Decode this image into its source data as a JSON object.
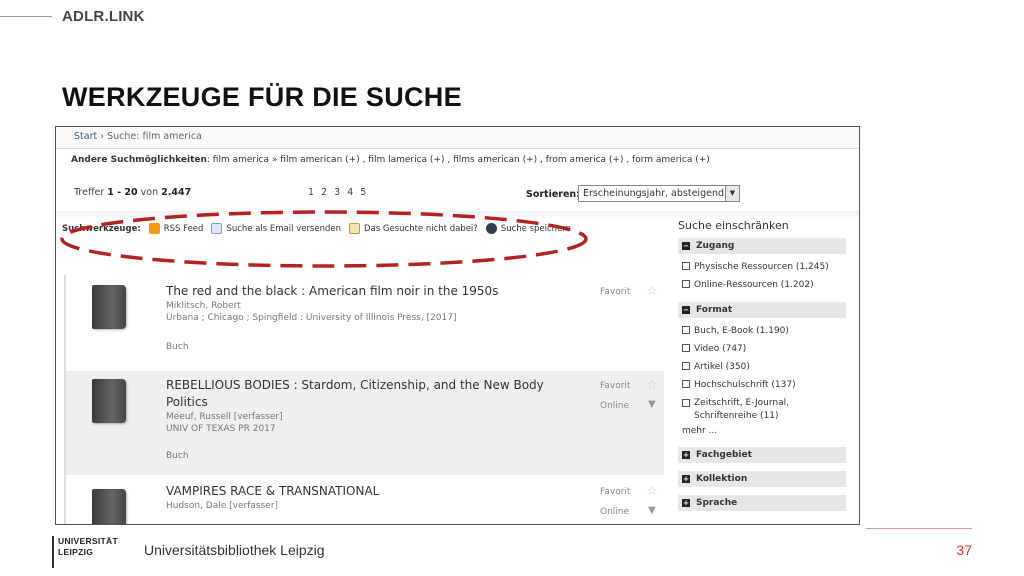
{
  "slide": {
    "brand": "ADLR.LINK",
    "title": "WERKZEUGE FÜR DIE SUCHE",
    "footer_text": "Universitätsbibliothek Leipzig",
    "page_number": "37",
    "logo_line1": "UNIVERSITÄT",
    "logo_line2": "LEIPZIG",
    "accent_color": "#c0392b"
  },
  "breadcrumb": {
    "home": "Start",
    "separator": "›",
    "current": "Suche: film america"
  },
  "alternatives": {
    "label": "Andere Suchmöglichkeiten",
    "text": ": film america » film american (+) , film lamerica (+) , films american (+) , from america (+) , form america (+)"
  },
  "hits": {
    "prefix": "Treffer ",
    "range": "1 - 20",
    "of": " von ",
    "total": "2.447",
    "pages": "1 2 3 4 5"
  },
  "sort": {
    "label": "Sortieren:",
    "value": "Erscheinungsjahr, absteigend"
  },
  "tools": {
    "label": "Suchwerkzeuge:",
    "rss": "RSS Feed",
    "email": "Suche als Email versenden",
    "missing": "Das Gesuchte nicht dabei?",
    "save": "Suche speichern"
  },
  "results": [
    {
      "title": "The red and the black : American film noir in the 1950s",
      "author": "Miklitsch, Robert",
      "publisher": "Urbana ; Chicago ; Spingfield : University of Illinois Press, [2017]",
      "type": "Buch",
      "favorite": "Favorit"
    },
    {
      "title": "REBELLIOUS BODIES : Stardom, Citizenship, and the New Body Politics",
      "author": "Meeuf, Russell [verfasser]",
      "publisher": "UNIV OF TEXAS PR 2017",
      "type": "Buch",
      "favorite": "Favorit",
      "online": "Online"
    },
    {
      "title": "VAMPIRES RACE & TRANSNATIONAL",
      "author": "Hudson, Dale [verfasser]",
      "favorite": "Favorit",
      "online": "Online"
    }
  ],
  "facets": {
    "heading": "Suche einschränken",
    "zugang": {
      "label": "Zugang",
      "items": [
        "Physische Ressourcen (1.245)",
        "Online-Ressourcen (1.202)"
      ]
    },
    "format": {
      "label": "Format",
      "items": [
        "Buch, E-Book (1.190)",
        "Video (747)",
        "Artikel (350)",
        "Hochschulschrift (137)",
        "Zeitschrift, E-Journal, Schriftenreihe (11)"
      ],
      "more": "mehr ..."
    },
    "fachgebiet": "Fachgebiet",
    "kollektion": "Kollektion",
    "sprache": "Sprache"
  }
}
